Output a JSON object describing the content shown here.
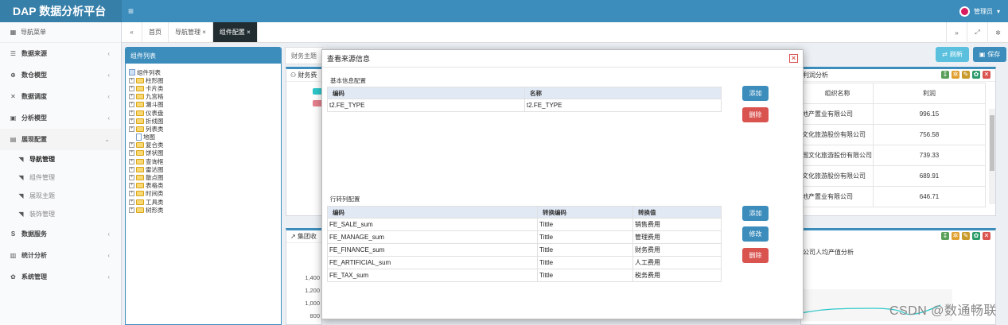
{
  "app": {
    "title": "DAP 数据分析平台",
    "menu_icon": "≡",
    "user_label": "管理员",
    "user_caret": "▾"
  },
  "sidebar": {
    "header": "导航菜单",
    "items": [
      {
        "label": "数据来源",
        "arrow": "‹",
        "icon": "☰"
      },
      {
        "label": "数仓模型",
        "arrow": "‹",
        "icon": "⊕"
      },
      {
        "label": "数据调度",
        "arrow": "‹",
        "icon": "✕"
      },
      {
        "label": "分析模型",
        "arrow": "‹",
        "icon": "▣"
      },
      {
        "label": "展现配置",
        "arrow": "⌄",
        "icon": "▤"
      }
    ],
    "subitems": [
      "导航管理",
      "组件管理",
      "展现主题",
      "装饰管理"
    ],
    "items2": [
      {
        "label": "数据服务",
        "arrow": "‹",
        "icon": "S"
      },
      {
        "label": "统计分析",
        "arrow": "‹",
        "icon": "▥"
      },
      {
        "label": "系统管理",
        "arrow": "‹",
        "icon": "✿"
      }
    ]
  },
  "tabs": {
    "back": "«",
    "home": "首页",
    "t1": "导航管理 ×",
    "t2": "组件配置 ×",
    "fwd": "»",
    "full": "⤢",
    "set": "✲"
  },
  "left_panel": {
    "title": "组件列表",
    "root": "组件列表",
    "nodes": [
      {
        "label": "柱形图",
        "pm": "+",
        "type": "folder"
      },
      {
        "label": "卡片类",
        "pm": "+",
        "type": "folder"
      },
      {
        "label": "九宫格",
        "pm": "+",
        "type": "folder"
      },
      {
        "label": "漏斗图",
        "pm": "+",
        "type": "folder"
      },
      {
        "label": "仪表盘",
        "pm": "+",
        "type": "folder"
      },
      {
        "label": "折线图",
        "pm": "+",
        "type": "folder"
      },
      {
        "label": "列表类",
        "pm": "+",
        "type": "folder"
      },
      {
        "label": "地图",
        "pm": "",
        "type": "leaf"
      },
      {
        "label": "复合类",
        "pm": "+",
        "type": "folder"
      },
      {
        "label": "饼状图",
        "pm": "+",
        "type": "folder"
      },
      {
        "label": "查询框",
        "pm": "+",
        "type": "folder"
      },
      {
        "label": "雷达图",
        "pm": "+",
        "type": "folder"
      },
      {
        "label": "散点图",
        "pm": "+",
        "type": "folder"
      },
      {
        "label": "表格类",
        "pm": "+",
        "type": "folder"
      },
      {
        "label": "时间类",
        "pm": "+",
        "type": "folder"
      },
      {
        "label": "工具类",
        "pm": "+",
        "type": "folder"
      },
      {
        "label": "树形类",
        "pm": "+",
        "type": "folder"
      }
    ]
  },
  "main": {
    "theme_tab": "财务主题",
    "refresh_label": "刷新",
    "save_label": "保存",
    "box1_title": "财务费",
    "box2_title": "集团收",
    "right_box1": {
      "title": "利润分析",
      "headers": [
        "组织名称",
        "利润"
      ],
      "rows": [
        {
          "name": "地产置业有限公司",
          "value": "996.15"
        },
        {
          "name": "文化旅游股份有限公司",
          "value": "756.58"
        },
        {
          "name": "国文化旅游股份有限公司",
          "value": "739.33"
        },
        {
          "name": "文化旅游股份有限公司",
          "value": "689.91"
        },
        {
          "name": "地产置业有限公司",
          "value": "646.71"
        }
      ]
    },
    "right_box2": {
      "title": "公司人均产值分析"
    },
    "y_ticks": [
      "1,400",
      "1,200",
      "1,000",
      "800"
    ]
  },
  "modal": {
    "title": "查看来源信息",
    "close": "×",
    "basic": {
      "section": "基本信息配置",
      "headers": [
        "编码",
        "名称"
      ],
      "rows": [
        [
          "t2.FE_TYPE",
          "t2.FE_TYPE"
        ]
      ],
      "add": "添加",
      "delete": "删除"
    },
    "pivot": {
      "section": "行转列配置",
      "headers": [
        "编码",
        "转换编码",
        "转换值"
      ],
      "rows": [
        [
          "FE_SALE_sum",
          "Tittle",
          "销售费用"
        ],
        [
          "FE_MANAGE_sum",
          "Tittle",
          "管理费用"
        ],
        [
          "FE_FINANCE_sum",
          "Tittle",
          "财务费用"
        ],
        [
          "FE_ARTIFICIAL_sum",
          "Tittle",
          "人工费用"
        ],
        [
          "FE_TAX_sum",
          "Tittle",
          "税务费用"
        ]
      ],
      "add": "添加",
      "edit": "修改",
      "delete": "删除"
    }
  },
  "watermark": "CSDN @数通畅联",
  "colors": {
    "primary": "#3c8dbc",
    "dark": "#222d32",
    "danger": "#d9534f",
    "info": "#5bc0de"
  }
}
